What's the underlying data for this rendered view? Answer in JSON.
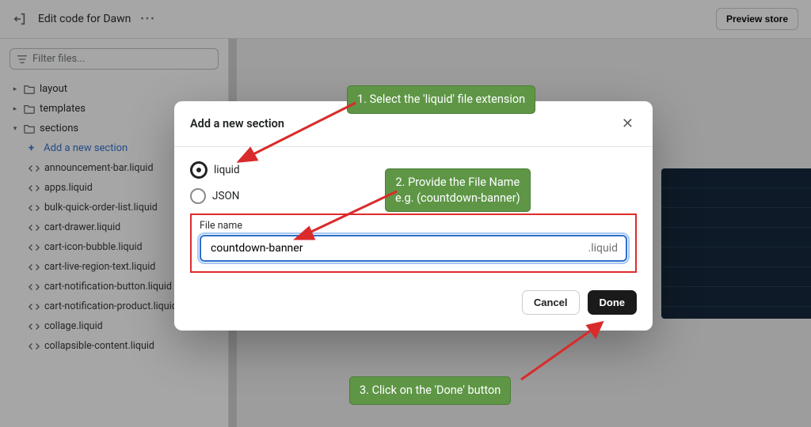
{
  "topbar": {
    "title": "Edit code for Dawn",
    "preview": "Preview store"
  },
  "filter": {
    "placeholder": "Filter files..."
  },
  "tree": {
    "layout": "layout",
    "templates": "templates",
    "sections": "sections",
    "add": "Add a new section",
    "files": [
      "announcement-bar.liquid",
      "apps.liquid",
      "bulk-quick-order-list.liquid",
      "cart-drawer.liquid",
      "cart-icon-bubble.liquid",
      "cart-live-region-text.liquid",
      "cart-notification-button.liquid",
      "cart-notification-product.liquid",
      "collage.liquid",
      "collapsible-content.liquid"
    ]
  },
  "modal": {
    "title": "Add a new section",
    "opt_liquid": "liquid",
    "opt_json": "JSON",
    "file_label": "File name",
    "file_value": "countdown-banner",
    "ext": ".liquid",
    "cancel": "Cancel",
    "done": "Done"
  },
  "callouts": {
    "c1": "1. Select the 'liquid' file extension",
    "c2": "2. Provide the File Name\ne.g. (countdown-banner)",
    "c3": "3. Click on the 'Done' button"
  }
}
